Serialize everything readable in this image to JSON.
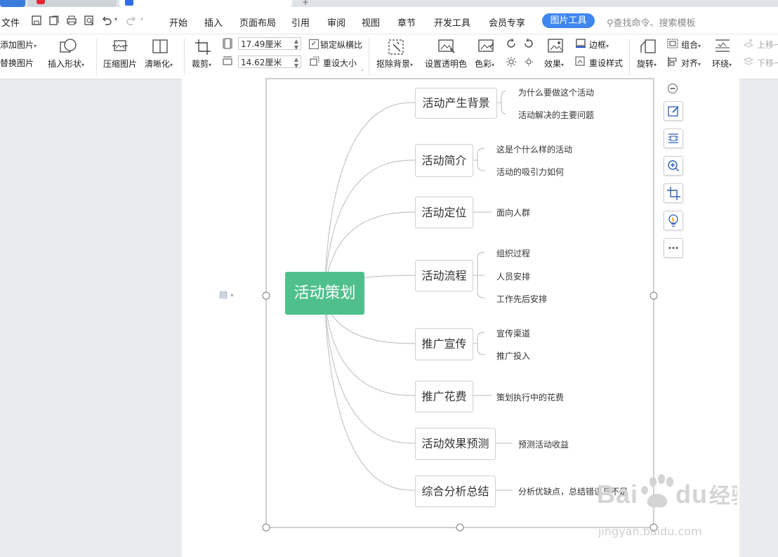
{
  "menubar": {
    "file": "文件",
    "tabs": [
      "开始",
      "插入",
      "页面布局",
      "引用",
      "审阅",
      "视图",
      "章节",
      "开发工具",
      "会员专享"
    ],
    "active_tab": "图片工具",
    "search": "查找命令、搜索模板"
  },
  "ribbon": {
    "add_image": "添加图片",
    "replace_image": "替换图片",
    "insert_shape": "插入形状",
    "compress_image": "压缩图片",
    "clarify": "清晰化",
    "crop": "裁剪",
    "width_value": "17.49厘米",
    "height_value": "14.62厘米",
    "lock_ratio": "锁定纵横比",
    "lock_ratio_checked": true,
    "reset_size": "重设大小",
    "remove_bg": "抠除背景",
    "set_transparent": "设置透明色",
    "color": "色彩",
    "effects": "效果",
    "border": "边框",
    "reset_style": "重设样式",
    "rotate": "旋转",
    "group": "组合",
    "align": "对齐",
    "wrap": "环绕",
    "bring_forward": "上移一",
    "send_backward": "下移一"
  },
  "mindmap": {
    "center": "活动策划",
    "branches": [
      {
        "label": "活动产生背景",
        "leaves": [
          "为什么要做这个活动",
          "活动解决的主要问题"
        ]
      },
      {
        "label": "活动简介",
        "leaves": [
          "这是个什么样的活动",
          "活动的吸引力如何"
        ]
      },
      {
        "label": "活动定位",
        "leaves": [
          "面向人群"
        ]
      },
      {
        "label": "活动流程",
        "leaves": [
          "组织过程",
          "人员安排",
          "工作先后安排"
        ]
      },
      {
        "label": "推广宣传",
        "leaves": [
          "宣传渠道",
          "推广投入"
        ]
      },
      {
        "label": "推广花费",
        "leaves": [
          "策划执行中的花费"
        ]
      },
      {
        "label": "活动效果预测",
        "leaves": [
          "预测活动收益"
        ]
      },
      {
        "label": "综合分析总结",
        "leaves": [
          "分析优缺点，总结错误与不足"
        ]
      }
    ]
  },
  "watermark": {
    "logo": "Bai du 经验",
    "url": "jingyan.baidu.com"
  },
  "colors": {
    "accent": "#3f87ef",
    "center_node": "#4fc08d"
  }
}
